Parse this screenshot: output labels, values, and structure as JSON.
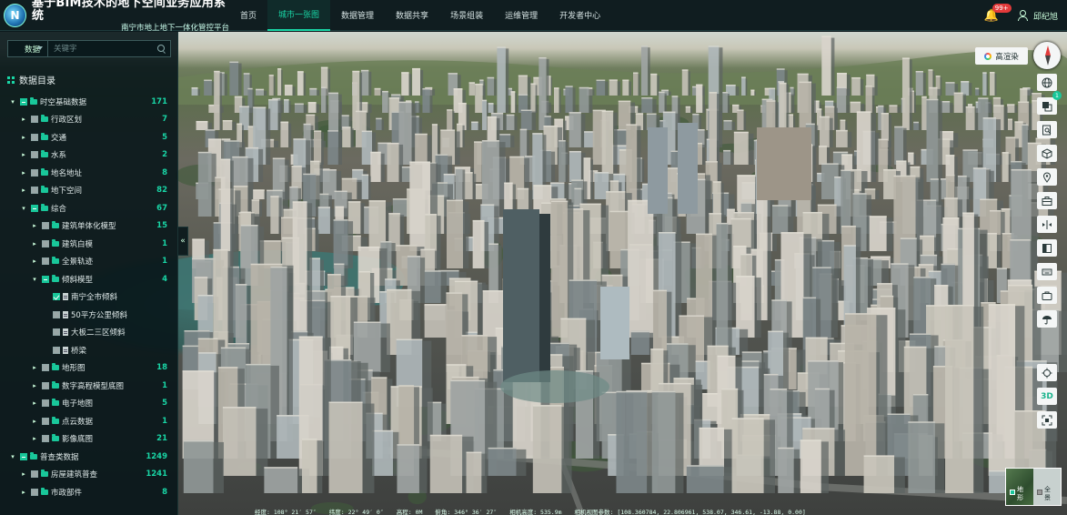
{
  "header": {
    "logo_text": "N",
    "title": "基于BIM技术的地下空间业务应用系统",
    "subtitle": "南宁市地上地下一体化管控平台",
    "nav": [
      {
        "label": "首页",
        "active": false
      },
      {
        "label": "城市一张图",
        "active": true
      },
      {
        "label": "数据管理",
        "active": false
      },
      {
        "label": "数据共享",
        "active": false
      },
      {
        "label": "场景组装",
        "active": false
      },
      {
        "label": "运维管理",
        "active": false
      },
      {
        "label": "开发者中心",
        "active": false
      }
    ],
    "notification_badge": "99+",
    "user_name": "邱纪旭"
  },
  "sidebar": {
    "search": {
      "select_value": "数据",
      "placeholder": "关键字"
    },
    "catalog_title": "数据目录",
    "tree": [
      {
        "level": 0,
        "expanded": true,
        "check": "partial",
        "type": "folder",
        "label": "时空基础数据",
        "count": "171"
      },
      {
        "level": 1,
        "expanded": false,
        "check": "none",
        "type": "folder",
        "label": "行政区划",
        "count": "7"
      },
      {
        "level": 1,
        "expanded": false,
        "check": "none",
        "type": "folder",
        "label": "交通",
        "count": "5"
      },
      {
        "level": 1,
        "expanded": false,
        "check": "none",
        "type": "folder",
        "label": "水系",
        "count": "2"
      },
      {
        "level": 1,
        "expanded": false,
        "check": "none",
        "type": "folder",
        "label": "地名地址",
        "count": "8"
      },
      {
        "level": 1,
        "expanded": false,
        "check": "none",
        "type": "folder",
        "label": "地下空间",
        "count": "82"
      },
      {
        "level": 1,
        "expanded": true,
        "check": "partial",
        "type": "folder",
        "label": "综合",
        "count": "67"
      },
      {
        "level": 2,
        "expanded": false,
        "check": "none",
        "type": "folder",
        "label": "建筑单体化模型",
        "count": "15"
      },
      {
        "level": 2,
        "expanded": false,
        "check": "none",
        "type": "folder",
        "label": "建筑白模",
        "count": "1"
      },
      {
        "level": 2,
        "expanded": false,
        "check": "none",
        "type": "folder",
        "label": "全景轨迹",
        "count": "1"
      },
      {
        "level": 2,
        "expanded": true,
        "check": "partial",
        "type": "folder",
        "label": "倾斜模型",
        "count": "4"
      },
      {
        "level": 3,
        "expanded": null,
        "check": "checked",
        "type": "file",
        "label": "南宁全市倾斜",
        "count": ""
      },
      {
        "level": 3,
        "expanded": null,
        "check": "none",
        "type": "file",
        "label": "50平方公里倾斜",
        "count": ""
      },
      {
        "level": 3,
        "expanded": null,
        "check": "none",
        "type": "file",
        "label": "大板二三区倾斜",
        "count": ""
      },
      {
        "level": 3,
        "expanded": null,
        "check": "none",
        "type": "file",
        "label": "桥梁",
        "count": ""
      },
      {
        "level": 2,
        "expanded": false,
        "check": "none",
        "type": "folder",
        "label": "地形图",
        "count": "18"
      },
      {
        "level": 2,
        "expanded": false,
        "check": "none",
        "type": "folder",
        "label": "数字高程模型底图",
        "count": "1"
      },
      {
        "level": 2,
        "expanded": false,
        "check": "none",
        "type": "folder",
        "label": "电子地图",
        "count": "5"
      },
      {
        "level": 2,
        "expanded": false,
        "check": "none",
        "type": "folder",
        "label": "点云数据",
        "count": "1"
      },
      {
        "level": 2,
        "expanded": false,
        "check": "none",
        "type": "folder",
        "label": "影像底图",
        "count": "21"
      },
      {
        "level": 0,
        "expanded": true,
        "check": "partial",
        "type": "folder",
        "label": "普查类数据",
        "count": "1249"
      },
      {
        "level": 1,
        "expanded": false,
        "check": "none",
        "type": "folder",
        "label": "房屋建筑普查",
        "count": "1241"
      },
      {
        "level": 1,
        "expanded": false,
        "check": "none",
        "type": "folder",
        "label": "市政部件",
        "count": "8"
      }
    ],
    "collapse_glyph": "«"
  },
  "map": {
    "render_label": "高渲染",
    "tool_badge": "1",
    "three_d_label": "3D",
    "basemap": {
      "terrain_label": "地形",
      "full_label": "全景"
    },
    "status": {
      "lon": "经度: 108° 21′ 57″",
      "lat": "纬度: 22° 49′ 0″",
      "alt": "高程: 0M",
      "pitch": "俯角: 346° 36′ 27″",
      "cam": "相机高度: 535.9m",
      "view": "相机视图参数: [108.360784, 22.806961, 538.07, 346.61, -13.88, 0.00]"
    }
  }
}
